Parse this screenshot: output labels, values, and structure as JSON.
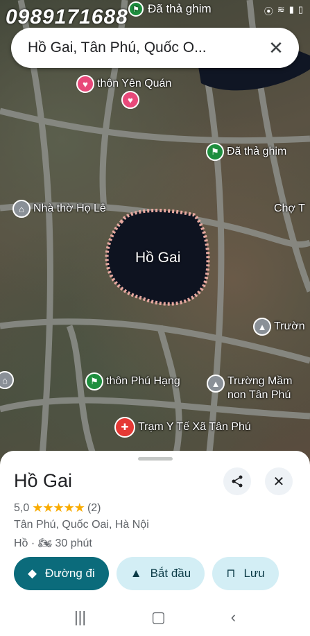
{
  "watermark": "0989171688",
  "status": {
    "pin_label": "Đã thả ghim",
    "icons": [
      "location-icon",
      "wifi-icon",
      "signal-icon",
      "battery-icon"
    ]
  },
  "search": {
    "value": "Hồ Gai, Tân Phú, Quốc O...",
    "close": "✕"
  },
  "map": {
    "lake_name": "Hồ Gai",
    "pois": [
      {
        "label": "thôn Yên Quán",
        "icon": "heart-icon"
      },
      {
        "label": "",
        "icon": "heart-icon"
      },
      {
        "label": "Đã thả ghim",
        "icon": "flag-icon"
      },
      {
        "label": "Nhà thờ Họ Lê",
        "icon": "temple-icon"
      },
      {
        "label": "Chợ T",
        "icon": ""
      },
      {
        "label": "Trườn",
        "icon": "school-icon"
      },
      {
        "label": "thôn Phú Hạng",
        "icon": "flag-icon"
      },
      {
        "label": "Trường Mầm\nnon Tân Phú",
        "icon": "school-icon"
      },
      {
        "label": "Trạm Y Tế Xã Tân Phú",
        "icon": "hospital-icon"
      }
    ]
  },
  "place": {
    "title": "Hồ Gai",
    "rating": "5,0",
    "stars": "★★★★★",
    "reviews": "(2)",
    "address": "Tân Phú, Quốc Oai, Hà Nội",
    "category": "Hồ",
    "travel_time": "30 phút"
  },
  "actions": {
    "directions": "Đường đi",
    "start": "Bắt đầu",
    "save": "Lưu"
  },
  "colors": {
    "primary": "#0b6b7b",
    "secondary": "#d3eef5",
    "star": "#f9ab00"
  }
}
